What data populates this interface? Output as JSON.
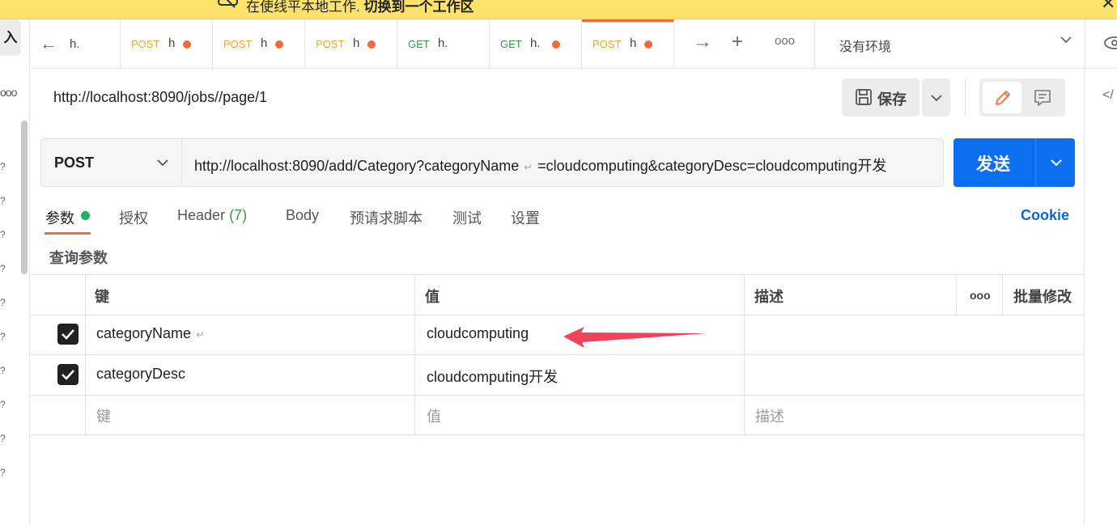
{
  "banner": {
    "text": "在使线平本地工作.",
    "bold_text": "切换到一个工作区"
  },
  "sidebar": {
    "import_label": "入"
  },
  "tabs": {
    "back_label": "h.",
    "items": [
      {
        "method": "POST",
        "title": "h",
        "unsaved": true
      },
      {
        "method": "POST",
        "title": "h",
        "unsaved": true
      },
      {
        "method": "POST",
        "title": "h",
        "unsaved": true
      },
      {
        "method": "GET",
        "title": "h.",
        "unsaved": false
      },
      {
        "method": "GET",
        "title": "h.",
        "unsaved": true
      },
      {
        "method": "POST",
        "title": "h",
        "unsaved": true,
        "active": true
      }
    ],
    "environment": "没有环境"
  },
  "request": {
    "name": "http://localhost:8090/jobs//page/1",
    "save_label": "保存",
    "method": "POST",
    "url_part1": "http://localhost:8090/add/Category?categoryName",
    "url_part2": "=cloudcomputing&categoryDesc=cloudcomputing开发",
    "send_label": "发送"
  },
  "subtabs": {
    "params": "参数",
    "auth": "授权",
    "header": "Header",
    "header_count": "(7)",
    "body": "Body",
    "prerequest": "预请求脚本",
    "tests": "测试",
    "settings": "设置",
    "cookie": "Cookie"
  },
  "query": {
    "title": "查询参数",
    "headers": {
      "key": "键",
      "value": "值",
      "desc": "描述",
      "more": "ooo",
      "bulk": "批量修改"
    },
    "rows": [
      {
        "key": "categoryName",
        "value": "cloudcomputing",
        "checked": true
      },
      {
        "key": "categoryDesc",
        "value": "cloudcomputing开发",
        "checked": true
      }
    ],
    "placeholder": {
      "key": "键",
      "value": "值",
      "desc": "描述"
    }
  },
  "colors": {
    "accent": "#f26b3a",
    "send": "#0c6ff0",
    "banner": "#fbe26a",
    "post": "#f5a623",
    "get": "#2f9e44",
    "annotation_arrow": "#f0435a"
  }
}
